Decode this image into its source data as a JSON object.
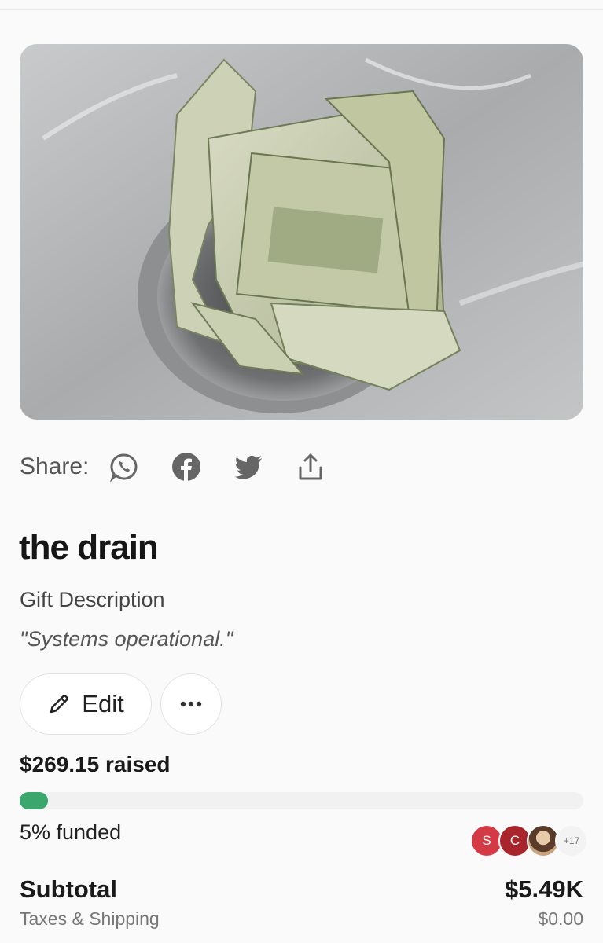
{
  "share": {
    "label": "Share:",
    "icons": [
      "whatsapp-icon",
      "facebook-icon",
      "twitter-icon",
      "share-upload-icon"
    ]
  },
  "gift": {
    "title": "the drain",
    "description_label": "Gift Description",
    "description": "\"Systems operational.\""
  },
  "actions": {
    "edit_label": "Edit",
    "more_icon": "more-dots-icon"
  },
  "funding": {
    "raised_text": "$269.15 raised",
    "funded_text": "5% funded",
    "progress_fraction": 0.05,
    "supporters": [
      {
        "initial": "S",
        "color": "#d33a46"
      },
      {
        "initial": "C",
        "color": "#a8252c"
      }
    ],
    "more_count": "+17"
  },
  "totals": {
    "subtotal_label": "Subtotal",
    "subtotal_value": "$5.49K",
    "taxes_label": "Taxes & Shipping",
    "taxes_value": "$0.00"
  },
  "colors": {
    "progress": "#3aa76d",
    "background": "#fafafa"
  }
}
